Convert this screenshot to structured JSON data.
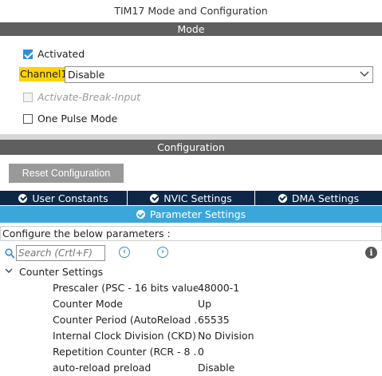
{
  "window_title": "TIM17 Mode and Configuration",
  "mode_header": "Mode",
  "activated": {
    "label": "Activated",
    "checked": true
  },
  "channel": {
    "label": "Channel1",
    "value": "Disable"
  },
  "break_input": {
    "label": "Activate-Break-Input",
    "checked": false,
    "disabled": true
  },
  "one_pulse": {
    "label": "One Pulse Mode",
    "checked": false
  },
  "config_header": "Configuration",
  "reset_button": "Reset Configuration",
  "tabs": [
    {
      "label": "User Constants"
    },
    {
      "label": "NVIC Settings"
    },
    {
      "label": "DMA Settings"
    }
  ],
  "active_tab": {
    "label": "Parameter Settings"
  },
  "configure_text": "Configure the below parameters :",
  "search": {
    "placeholder": "Search (Crtl+F)"
  },
  "nav": {
    "prev": "‹",
    "next": "›"
  },
  "info": "i",
  "counter_settings": {
    "title": "Counter Settings",
    "rows": [
      {
        "name": "Prescaler (PSC - 16 bits value)",
        "value": "48000-1"
      },
      {
        "name": "Counter Mode",
        "value": "Up"
      },
      {
        "name": "Counter Period (AutoReload ...",
        "value": "65535"
      },
      {
        "name": "Internal Clock Division (CKD)",
        "value": "No Division"
      },
      {
        "name": "Repetition Counter (RCR - 8 ...",
        "value": "0"
      },
      {
        "name": "auto-reload preload",
        "value": "Disable"
      }
    ]
  },
  "colors": {
    "section_bar": "#5f5f5f",
    "tab_dark": "#0e2747",
    "tab_active": "#3ba6d9",
    "highlight": "#ffd200",
    "accent": "#2f8fd6"
  }
}
